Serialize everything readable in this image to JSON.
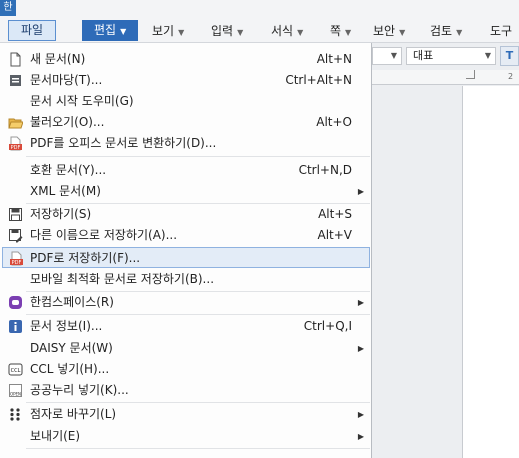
{
  "app": {
    "logo": "한"
  },
  "menubar": {
    "file": "파일",
    "edit": "편집",
    "view": "보기",
    "input": "입력",
    "format": "서식",
    "page": "쪽",
    "security": "보안",
    "review": "검토",
    "tools": "도구"
  },
  "toolbar": {
    "style_value": "대표",
    "tool_glyph": "T",
    "ruler_number": "2"
  },
  "menu": {
    "new_doc": "새 문서(N)",
    "new_doc_sc": "Alt+N",
    "doc_mall": "문서마당(T)...",
    "doc_mall_sc": "Ctrl+Alt+N",
    "doc_start": "문서 시작 도우미(G)",
    "open": "불러오기(O)...",
    "open_sc": "Alt+O",
    "pdf_convert": "PDF를 오피스 문서로 변환하기(D)...",
    "compat": "호환 문서(Y)...",
    "compat_sc": "Ctrl+N,D",
    "xml": "XML 문서(M)",
    "save": "저장하기(S)",
    "save_sc": "Alt+S",
    "save_as": "다른 이름으로 저장하기(A)...",
    "save_as_sc": "Alt+V",
    "save_pdf": "PDF로 저장하기(F)...",
    "save_mobile": "모바일 최적화 문서로 저장하기(B)...",
    "hancom_space": "한컴스페이스(R)",
    "doc_info": "문서 정보(I)...",
    "doc_info_sc": "Ctrl+Q,I",
    "daisy": "DAISY 문서(W)",
    "ccl": "CCL 넣기(H)...",
    "kogl": "공공누리 넣기(K)...",
    "braille": "점자로 바꾸기(L)",
    "send": "보내기(E)",
    "pdf_badge": "PDF",
    "ccl_badge": "CCL",
    "kogl_badge": "OPEN"
  }
}
